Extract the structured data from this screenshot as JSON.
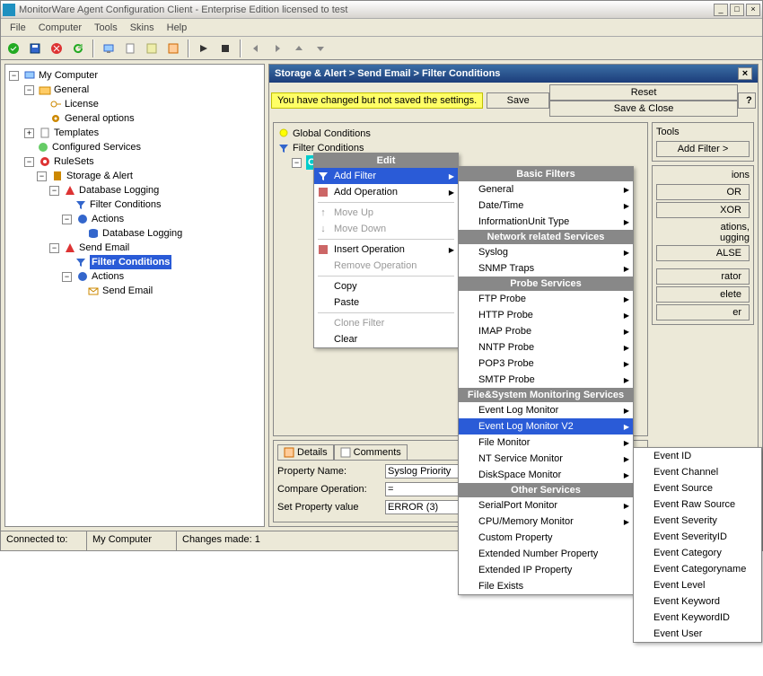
{
  "window": {
    "title": "MonitorWare Agent Configuration Client - Enterprise Edition licensed to test"
  },
  "menu": {
    "file": "File",
    "computer": "Computer",
    "tools": "Tools",
    "skins": "Skins",
    "help": "Help"
  },
  "tree": {
    "root": "My Computer",
    "general": "General",
    "license": "License",
    "genopt": "General options",
    "templates": "Templates",
    "cfgsvc": "Configured Services",
    "rulesets": "RuleSets",
    "sa": "Storage & Alert",
    "dbl": "Database Logging",
    "fc1": "Filter Conditions",
    "act1": "Actions",
    "dbl2": "Database Logging",
    "sendemail": "Send Email",
    "fc2": "Filter Conditions",
    "act2": "Actions",
    "se2": "Send Email"
  },
  "header": {
    "path": "Storage & Alert > Send Email > Filter Conditions"
  },
  "bar": {
    "warn": "You have changed but not saved the settings.",
    "save": "Save",
    "reset": "Reset",
    "sclose": "Save & Close"
  },
  "panel": {
    "global": "Global Conditions",
    "filter": "Filter Conditions",
    "op": "O"
  },
  "tools": {
    "title": "Tools",
    "addfilter": "Add Filter >",
    "boolops": "ions",
    "or": "OR",
    "xor": "XOR",
    "ations": "ations,",
    "ugging": "ugging",
    "alse": "ALSE",
    "rator": "rator",
    "delete": "elete",
    "er": "er"
  },
  "tabs": {
    "details": "Details",
    "comments": "Comments"
  },
  "props": {
    "pname": "Property Name:",
    "pval": "Syslog Priority",
    "cop": "Compare Operation:",
    "cval": "=",
    "spv": "Set Property value",
    "sval": "ERROR (3)"
  },
  "status": {
    "conn": "Connected to:",
    "mc": "My Computer",
    "changes": "Changes made: 1"
  },
  "ctx1": {
    "title": "Edit",
    "addf": "Add Filter",
    "addop": "Add Operation",
    "mu": "Move Up",
    "md": "Move Down",
    "iop": "Insert Operation",
    "rop": "Remove Operation",
    "copy": "Copy",
    "paste": "Paste",
    "clone": "Clone Filter",
    "clear": "Clear"
  },
  "ctx2": {
    "h1": "Basic Filters",
    "general": "General",
    "dt": "Date/Time",
    "iut": "InformationUnit Type",
    "h2": "Network related Services",
    "syslog": "Syslog",
    "snmp": "SNMP Traps",
    "h3": "Probe Services",
    "ftp": "FTP Probe",
    "http": "HTTP Probe",
    "imap": "IMAP Probe",
    "nntp": "NNTP Probe",
    "pop3": "POP3 Probe",
    "smtp": "SMTP Probe",
    "h4": "File&System Monitoring Services",
    "elm": "Event Log Monitor",
    "elm2": "Event Log Monitor V2",
    "fm": "File Monitor",
    "ntsm": "NT Service Monitor",
    "dsm": "DiskSpace Monitor",
    "h5": "Other Services",
    "spm": "SerialPort Monitor",
    "cmm": "CPU/Memory Monitor",
    "cp": "Custom Property",
    "enp": "Extended Number Property",
    "eip": "Extended IP Property",
    "fe": "File Exists"
  },
  "ctx3": {
    "eid": "Event ID",
    "ech": "Event Channel",
    "esrc": "Event Source",
    "ers": "Event Raw Source",
    "esev": "Event Severity",
    "esevid": "Event SeverityID",
    "ecat": "Event Category",
    "ecatn": "Event Categoryname",
    "elvl": "Event Level",
    "ekw": "Event Keyword",
    "ekwid": "Event KeywordID",
    "euser": "Event User"
  }
}
